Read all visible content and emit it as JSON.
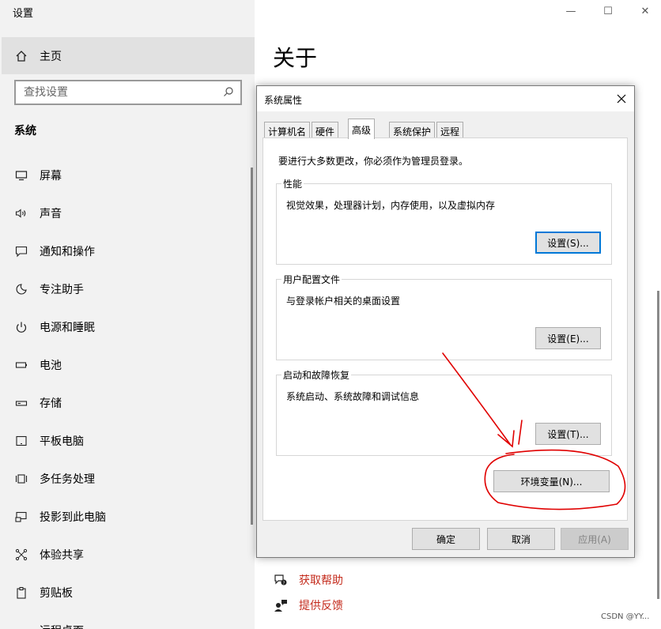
{
  "app": {
    "title": "设置"
  },
  "sidebar": {
    "home_label": "主页",
    "search_placeholder": "查找设置",
    "section_header": "系统",
    "items": [
      {
        "label": "屏幕",
        "icon": "monitor-icon"
      },
      {
        "label": "声音",
        "icon": "speaker-icon"
      },
      {
        "label": "通知和操作",
        "icon": "notification-icon"
      },
      {
        "label": "专注助手",
        "icon": "moon-icon"
      },
      {
        "label": "电源和睡眠",
        "icon": "power-icon"
      },
      {
        "label": "电池",
        "icon": "battery-icon"
      },
      {
        "label": "存储",
        "icon": "storage-icon"
      },
      {
        "label": "平板电脑",
        "icon": "tablet-icon"
      },
      {
        "label": "多任务处理",
        "icon": "multitask-icon"
      },
      {
        "label": "投影到此电脑",
        "icon": "project-icon"
      },
      {
        "label": "体验共享",
        "icon": "share-icon"
      },
      {
        "label": "剪贴板",
        "icon": "clipboard-icon"
      },
      {
        "label": "远程桌面",
        "icon": "remote-desktop-icon"
      }
    ]
  },
  "window_controls": {
    "minimize": "—",
    "maximize": "☐",
    "close": "✕"
  },
  "main": {
    "title": "关于",
    "links": [
      {
        "label": "获取帮助",
        "icon": "help-icon"
      },
      {
        "label": "提供反馈",
        "icon": "feedback-icon"
      }
    ]
  },
  "dialog": {
    "title": "系统属性",
    "tabs": [
      "计算机名",
      "硬件",
      "高级",
      "系统保护",
      "远程"
    ],
    "active_tab": "高级",
    "note": "要进行大多数更改，你必须作为管理员登录。",
    "groups": [
      {
        "title": "性能",
        "desc": "视觉效果，处理器计划，内存使用，以及虚拟内存",
        "button": "设置(S)..."
      },
      {
        "title": "用户配置文件",
        "desc": "与登录帐户相关的桌面设置",
        "button": "设置(E)..."
      },
      {
        "title": "启动和故障恢复",
        "desc": "系统启动、系统故障和调试信息",
        "button": "设置(T)..."
      }
    ],
    "env_button": "环境变量(N)...",
    "ok": "确定",
    "cancel": "取消",
    "apply": "应用(A)"
  },
  "annotation": {
    "color": "#e00000"
  },
  "watermark": "CSDN @YY..."
}
